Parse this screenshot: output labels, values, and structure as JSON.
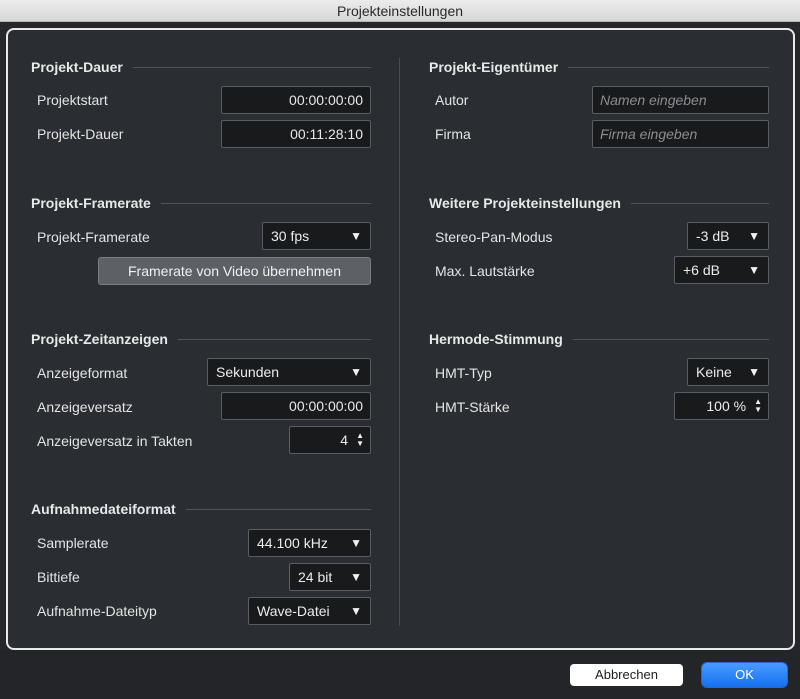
{
  "window": {
    "title": "Projekteinstellungen"
  },
  "left": {
    "duration": {
      "header": "Projekt-Dauer",
      "start_label": "Projektstart",
      "start_value": "00:00:00:00",
      "length_label": "Projekt-Dauer",
      "length_value": "00:11:28:10"
    },
    "framerate": {
      "header": "Projekt-Framerate",
      "label": "Projekt-Framerate",
      "value": "30 fps",
      "video_button": "Framerate von Video übernehmen"
    },
    "time_display": {
      "header": "Projekt-Zeitanzeigen",
      "format_label": "Anzeigeformat",
      "format_value": "Sekunden",
      "offset_label": "Anzeigeversatz",
      "offset_value": "00:00:00:00",
      "bars_offset_label": "Anzeigeversatz in Takten",
      "bars_offset_value": "4"
    },
    "recording": {
      "header": "Aufnahmedateiformat",
      "samplerate_label": "Samplerate",
      "samplerate_value": "44.100 kHz",
      "bitdepth_label": "Bittiefe",
      "bitdepth_value": "24 bit",
      "filetype_label": "Aufnahme-Dateityp",
      "filetype_value": "Wave-Datei"
    }
  },
  "right": {
    "owner": {
      "header": "Projekt-Eigentümer",
      "author_label": "Autor",
      "author_placeholder": "Namen eingeben",
      "company_label": "Firma",
      "company_placeholder": "Firma eingeben"
    },
    "more": {
      "header": "Weitere Projekteinstellungen",
      "panmode_label": "Stereo-Pan-Modus",
      "panmode_value": "-3 dB",
      "maxvol_label": "Max. Lautstärke",
      "maxvol_value": "+6 dB"
    },
    "hermode": {
      "header": "Hermode-Stimmung",
      "type_label": "HMT-Typ",
      "type_value": "Keine",
      "strength_label": "HMT-Stärke",
      "strength_value": "100 %"
    }
  },
  "footer": {
    "cancel": "Abbrechen",
    "ok": "OK"
  },
  "icons": {
    "dropdown": "▼",
    "step_up": "▲",
    "step_down": "▼"
  }
}
